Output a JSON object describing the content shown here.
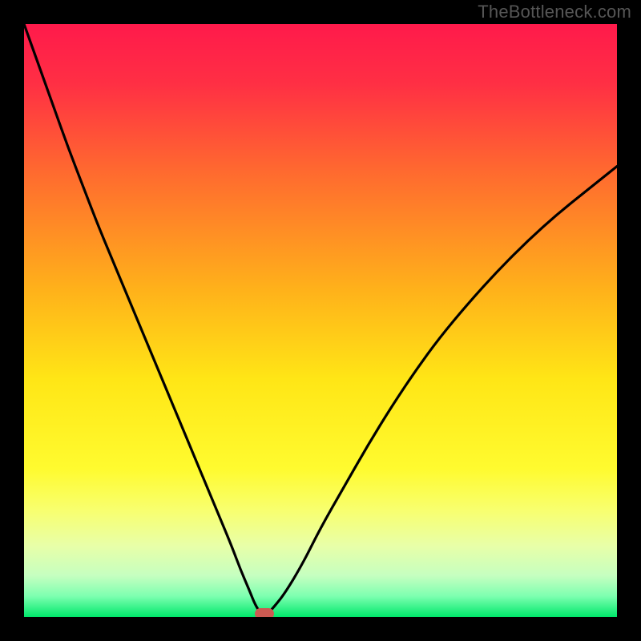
{
  "watermark": "TheBottleneck.com",
  "chart_data": {
    "type": "line",
    "title": "",
    "xlabel": "",
    "ylabel": "",
    "xlim": [
      0,
      100
    ],
    "ylim": [
      0,
      100
    ],
    "gradient_stops": [
      {
        "pos": 0.0,
        "color": "#ff1a4b"
      },
      {
        "pos": 0.1,
        "color": "#ff2f44"
      },
      {
        "pos": 0.25,
        "color": "#ff6a2f"
      },
      {
        "pos": 0.45,
        "color": "#ffb21a"
      },
      {
        "pos": 0.6,
        "color": "#ffe616"
      },
      {
        "pos": 0.75,
        "color": "#fffb2f"
      },
      {
        "pos": 0.82,
        "color": "#f8ff6f"
      },
      {
        "pos": 0.88,
        "color": "#e8ffa8"
      },
      {
        "pos": 0.93,
        "color": "#c6ffc0"
      },
      {
        "pos": 0.965,
        "color": "#7dffb0"
      },
      {
        "pos": 1.0,
        "color": "#00e86b"
      }
    ],
    "series": [
      {
        "name": "bottleneck-curve",
        "x": [
          0.0,
          2.5,
          5.0,
          7.5,
          10.0,
          12.5,
          15.0,
          17.5,
          20.0,
          22.5,
          25.0,
          27.5,
          30.0,
          32.5,
          35.0,
          36.5,
          38.0,
          39.0,
          40.0,
          41.0,
          42.0,
          44.0,
          47.0,
          50.0,
          54.0,
          58.0,
          62.0,
          66.0,
          70.0,
          75.0,
          80.0,
          85.0,
          90.0,
          95.0,
          100.0
        ],
        "y": [
          100.0,
          93.0,
          86.0,
          79.0,
          72.5,
          66.0,
          60.0,
          54.0,
          48.0,
          42.0,
          36.0,
          30.0,
          24.0,
          18.0,
          12.0,
          8.0,
          4.5,
          2.0,
          0.5,
          0.5,
          1.5,
          4.0,
          9.0,
          15.0,
          22.0,
          29.0,
          35.5,
          41.5,
          47.0,
          53.0,
          58.5,
          63.5,
          68.0,
          72.0,
          76.0
        ]
      }
    ],
    "flat_segment": {
      "x_start": 38.5,
      "x_end": 41.0,
      "y": 0.5
    },
    "marker": {
      "x": 40.5,
      "y": 0.5
    }
  }
}
